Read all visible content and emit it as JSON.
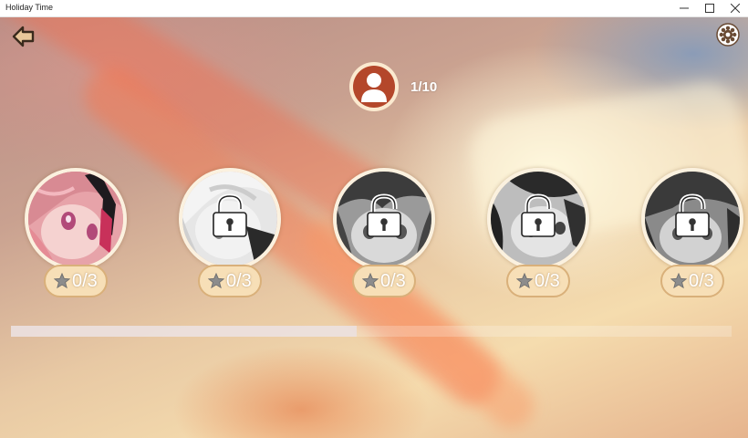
{
  "window": {
    "title": "Holiday Time",
    "controls": {
      "minimize_icon": "minimize-icon",
      "maximize_icon": "maximize-icon",
      "close_icon": "close-icon"
    }
  },
  "header": {
    "back_icon": "back-arrow-icon",
    "settings_icon": "gear-icon",
    "player_icon": "person-icon",
    "level_text": "1/10"
  },
  "stages": [
    {
      "score": "0/3",
      "locked": false,
      "icon": "star-icon"
    },
    {
      "score": "0/3",
      "locked": true,
      "icon": "star-icon"
    },
    {
      "score": "0/3",
      "locked": true,
      "icon": "star-icon"
    },
    {
      "score": "0/3",
      "locked": true,
      "icon": "star-icon"
    },
    {
      "score": "0/3",
      "locked": true,
      "icon": "star-icon"
    }
  ],
  "scroll": {
    "position_fraction": 0.48
  },
  "colors": {
    "accent": "#b4472b",
    "badge_bg": "#f7dfb7",
    "badge_border": "#d9b07a",
    "portrait_border": "#fbf1df"
  }
}
